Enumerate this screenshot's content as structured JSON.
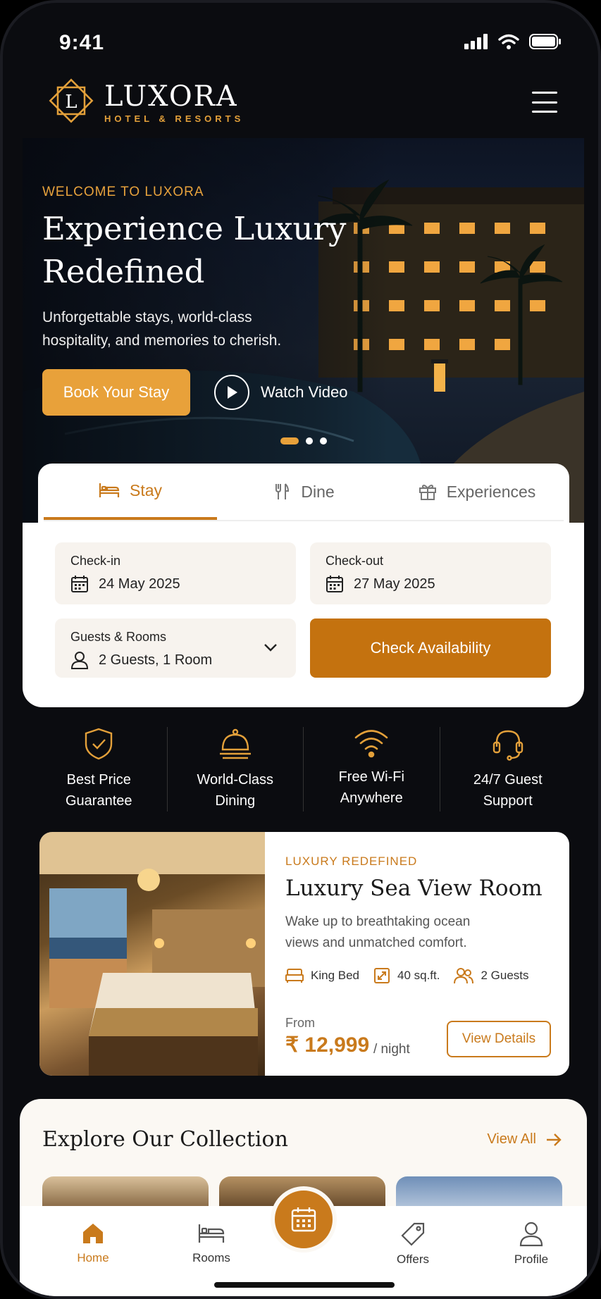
{
  "status": {
    "time": "9:41"
  },
  "brand": {
    "name": "LUXORA",
    "tagline": "HOTEL & RESORTS",
    "logo_letter": "L",
    "accent": "#e3a03a"
  },
  "hero": {
    "eyebrow": "WELCOME TO LUXORA",
    "title": "Experience Luxury Redefined",
    "subtitle": "Unforgettable stays, world-class hospitality, and memories to cherish.",
    "primary_button": "Book Your Stay",
    "secondary_button": "Watch Video",
    "slides_total": 3,
    "slide_active": 1
  },
  "booking": {
    "tabs": [
      {
        "label": "Stay",
        "icon": "bed-icon",
        "active": true
      },
      {
        "label": "Dine",
        "icon": "cutlery-icon",
        "active": false
      },
      {
        "label": "Experiences",
        "icon": "gift-icon",
        "active": false
      }
    ],
    "checkin": {
      "label": "Check-in",
      "value": "24 May 2025"
    },
    "checkout": {
      "label": "Check-out",
      "value": "27 May 2025"
    },
    "guests": {
      "label": "Guests & Rooms",
      "value": "2 Guests, 1 Room"
    },
    "cta": "Check Availability",
    "cta_color": "#c4720f"
  },
  "features": [
    {
      "line1": "Best Price",
      "line2": "Guarantee",
      "icon": "shield-check-icon"
    },
    {
      "line1": "World-Class",
      "line2": "Dining",
      "icon": "cloche-icon"
    },
    {
      "line1": "Free Wi-Fi",
      "line2": "Anywhere",
      "icon": "wifi-icon"
    },
    {
      "line1": "24/7 Guest",
      "line2": "Support",
      "icon": "headset-icon"
    }
  ],
  "room": {
    "eyebrow": "LUXURY REDEFINED",
    "title": "Luxury Sea View Room",
    "description": "Wake up to breathtaking ocean views and unmatched comfort.",
    "amenities": [
      {
        "label": "King Bed",
        "icon": "bed-icon"
      },
      {
        "label": "40 sq.ft.",
        "icon": "area-icon"
      },
      {
        "label": "2 Guests",
        "icon": "guests-icon"
      }
    ],
    "from_label": "From",
    "price": "₹ 12,999",
    "per": "/ night",
    "button": "View Details"
  },
  "collection": {
    "title": "Explore Our Collection",
    "view_all": "View All"
  },
  "nav": {
    "items": [
      {
        "label": "Home",
        "icon": "home-icon",
        "active": true
      },
      {
        "label": "Rooms",
        "icon": "bed-icon",
        "active": false
      },
      {
        "label": "",
        "icon": "calendar-icon",
        "active": false
      },
      {
        "label": "Offers",
        "icon": "tag-icon",
        "active": false
      },
      {
        "label": "Profile",
        "icon": "user-icon",
        "active": false
      }
    ]
  }
}
